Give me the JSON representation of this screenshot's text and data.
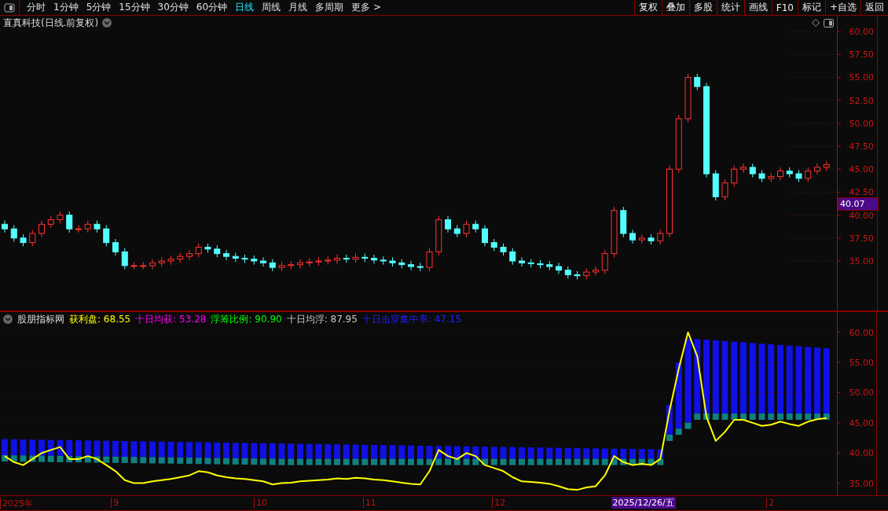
{
  "toolbar": {
    "periods": [
      {
        "label": "分时",
        "selected": false
      },
      {
        "label": "1分钟",
        "selected": false
      },
      {
        "label": "5分钟",
        "selected": false
      },
      {
        "label": "15分钟",
        "selected": false
      },
      {
        "label": "30分钟",
        "selected": false
      },
      {
        "label": "60分钟",
        "selected": false
      },
      {
        "label": "日线",
        "selected": true
      },
      {
        "label": "周线",
        "selected": false
      },
      {
        "label": "月线",
        "selected": false
      },
      {
        "label": "多周期",
        "selected": false
      },
      {
        "label": "更多 >",
        "selected": false
      }
    ],
    "buttons": [
      "复权",
      "叠加",
      "多股",
      "统计",
      "画线",
      "F10",
      "标记",
      "+自选",
      "返回"
    ]
  },
  "main_chart": {
    "title": "直真科技(日线.前复权)",
    "price_tag": "40.07",
    "axis_labels": [
      "60.00",
      "57.50",
      "55.00",
      "52.50",
      "50.00",
      "47.50",
      "45.00",
      "42.50",
      "40.00",
      "37.50",
      "35.00"
    ]
  },
  "indicator": {
    "name": "股朋指标网",
    "legend": [
      {
        "label": "获利盘:",
        "value": "68.55",
        "color": "#ffff00"
      },
      {
        "label": "十日均获:",
        "value": "53.28",
        "color": "#ff00ff"
      },
      {
        "label": "浮筹比例:",
        "value": "90.90",
        "color": "#00ff00"
      },
      {
        "label": "十日均浮:",
        "value": "87.95",
        "color": "#c8c8c8"
      },
      {
        "label": "十日击穿集中率:",
        "value": "47.15",
        "color": "#2020ff"
      }
    ],
    "chart_data": {
      "type": "line",
      "ylim": [
        33,
        61
      ],
      "grid": true,
      "yticks": [
        {
          "value": 60,
          "label": "60.00"
        },
        {
          "value": 55,
          "label": "55.00"
        },
        {
          "value": 50,
          "label": "50.00"
        },
        {
          "value": 45,
          "label": "45.00"
        },
        {
          "value": 40,
          "label": "40.00"
        },
        {
          "value": 35,
          "label": "35.00"
        }
      ],
      "series": [
        {
          "color": "#ffff00",
          "values": [
            39.5,
            38.5,
            38,
            39,
            40,
            40.5,
            41,
            39,
            39,
            39.5,
            39,
            38,
            37,
            35.5,
            35,
            35,
            35.3,
            35.5,
            35.7,
            36,
            36.3,
            37,
            36.8,
            36.3,
            36,
            35.8,
            35.7,
            35.5,
            35.3,
            34.8,
            35,
            35.1,
            35.3,
            35.4,
            35.5,
            35.6,
            35.8,
            35.7,
            35.9,
            35.8,
            35.6,
            35.5,
            35.3,
            35.1,
            34.9,
            34.8,
            37,
            40.5,
            39.5,
            39,
            40,
            39.5,
            38,
            37.5,
            37,
            36,
            35.3,
            35.2,
            35.1,
            34.9,
            34.5,
            34,
            33.9,
            34.3,
            34.5,
            36.3,
            39.5,
            38.5,
            38,
            38.2,
            38,
            39,
            47,
            54,
            60,
            56,
            46,
            42,
            43.5,
            45.5,
            45.5,
            45,
            44.5,
            44.7,
            45.2,
            44.8,
            44.5,
            45.2,
            45.6,
            45.8
          ]
        }
      ]
    },
    "time_axis": [
      "2025年",
      "9",
      "10",
      "11",
      "12",
      "2"
    ],
    "cursor": {
      "label": "2025/12/26/五"
    }
  }
}
